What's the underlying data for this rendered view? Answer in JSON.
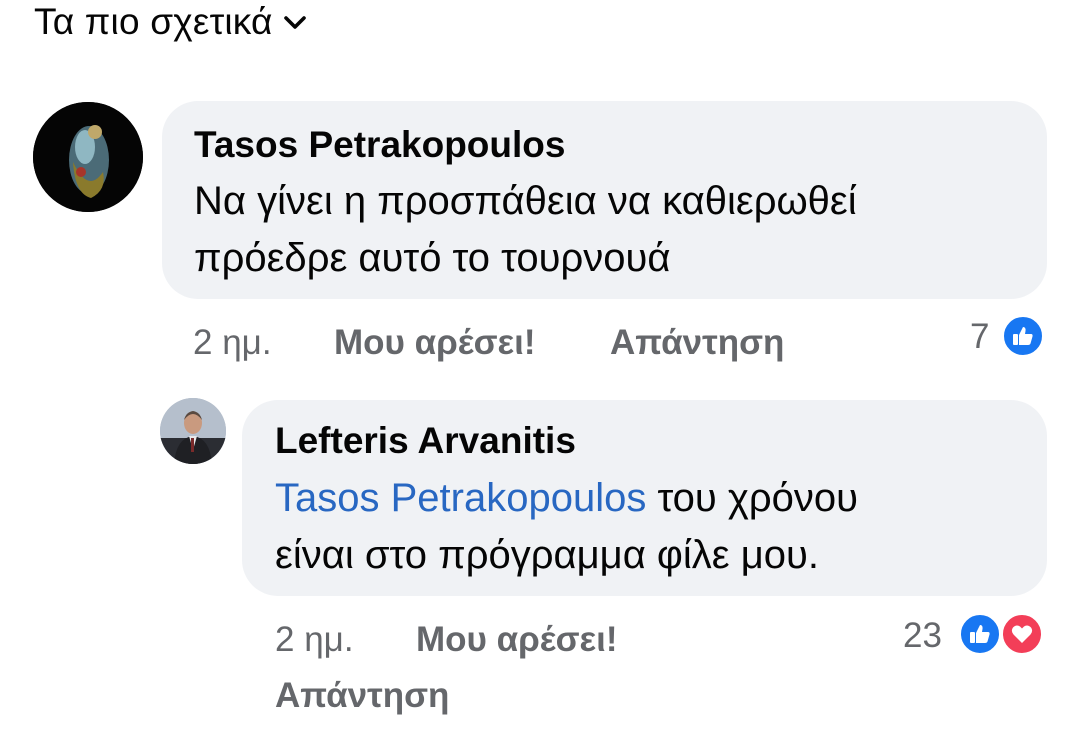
{
  "sort": {
    "label": "Τα πιο σχετικά"
  },
  "comments": [
    {
      "author": "Tasos Petrakopoulos",
      "lines": [
        "Να γίνει η προσπάθεια να καθιερωθεί",
        "πρόεδρε αυτό το τουρνουά"
      ],
      "time": "2 ημ.",
      "like_label": "Μου αρέσει!",
      "reply_label": "Απάντηση",
      "reaction_count": "7"
    },
    {
      "author": "Lefteris Arvanitis",
      "mention": "Tasos Petrakopoulos",
      "line1_rest": " του χρόνου",
      "line2": "είναι στο πρόγραμμα φίλε μου.",
      "time": "2 ημ.",
      "like_label": "Μου αρέσει!",
      "reply_label": "Απάντηση",
      "reaction_count": "23"
    }
  ],
  "icons": {
    "sort_chevron": "chevron-down-icon",
    "like_reaction": "like-reaction-icon",
    "love_reaction": "love-reaction-icon"
  },
  "colors": {
    "bubble": "#f0f2f5",
    "meta_text": "#65676b",
    "mention": "#2867c2",
    "like": "#1877f2",
    "love": "#f33e58"
  }
}
